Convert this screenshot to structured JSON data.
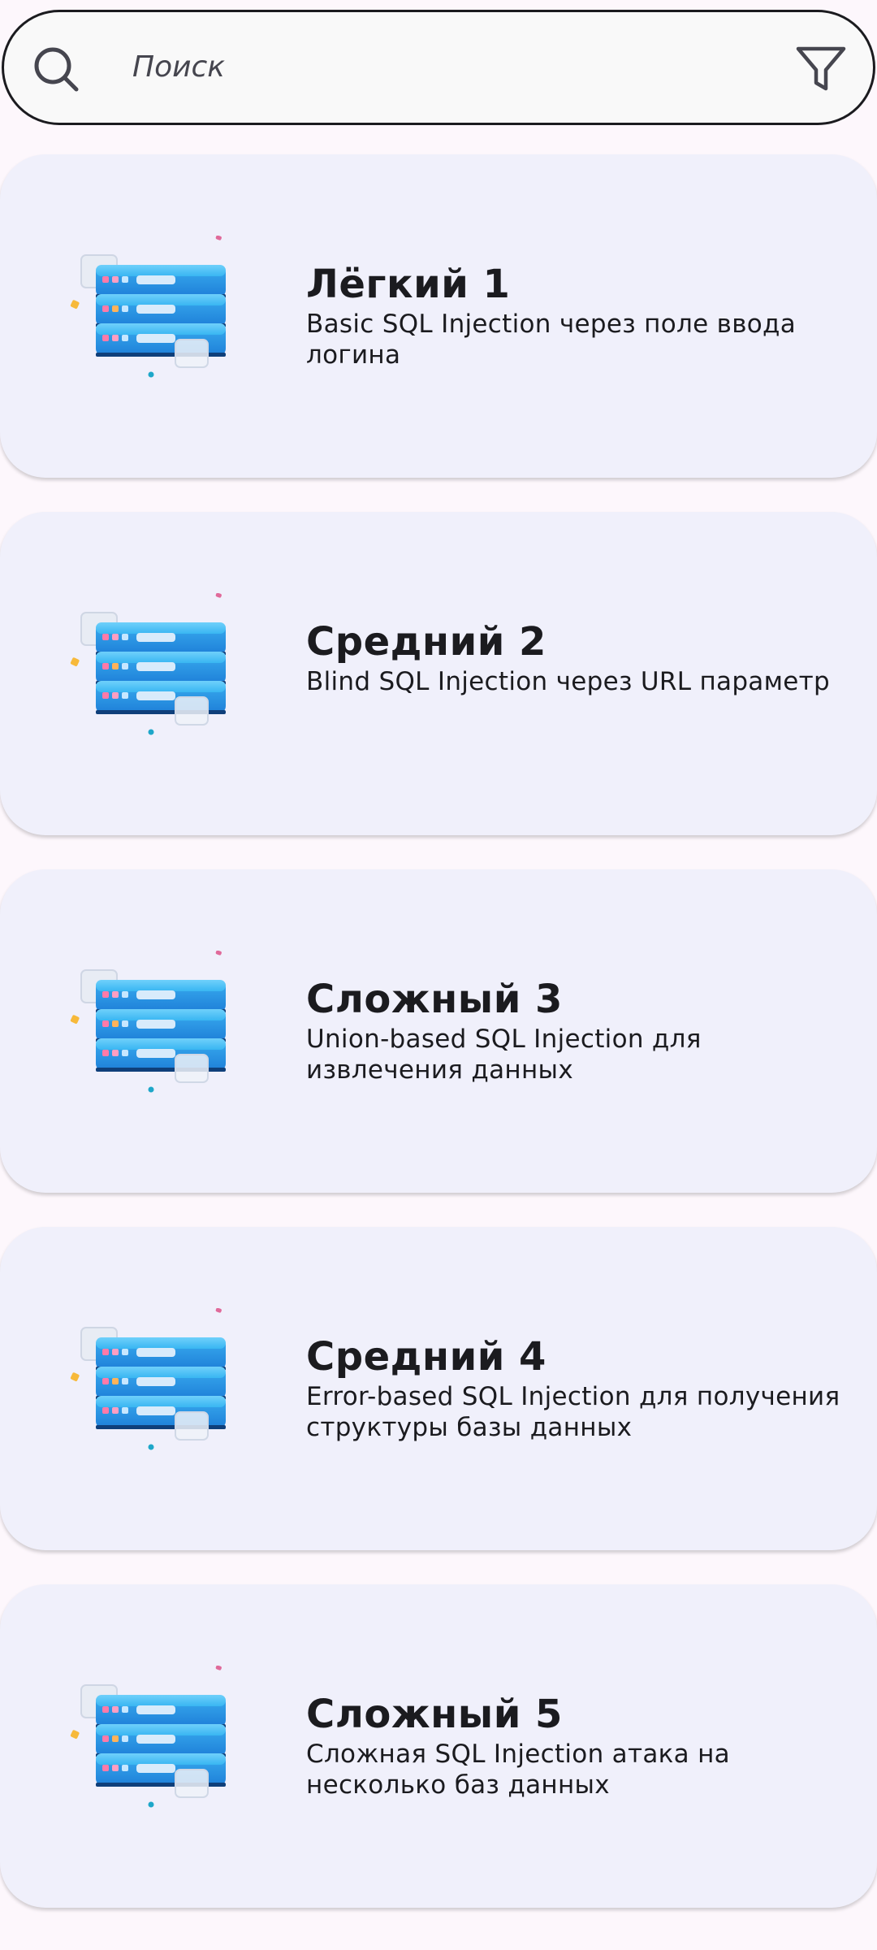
{
  "search": {
    "placeholder": "Поиск"
  },
  "tasks": [
    {
      "title": "Лёгкий 1",
      "description": "Basic SQL Injection через поле ввода логина",
      "icon": "server-stack-icon"
    },
    {
      "title": "Средний 2",
      "description": "Blind SQL Injection через URL параметр",
      "icon": "server-stack-icon"
    },
    {
      "title": "Сложный 3",
      "description": "Union-based SQL Injection для извлечения данных",
      "icon": "server-stack-icon"
    },
    {
      "title": "Средний 4",
      "description": "Error-based SQL Injection для получения структуры базы данных",
      "icon": "server-stack-icon"
    },
    {
      "title": "Сложный 5",
      "description": "Сложная SQL Injection атака на несколько баз данных",
      "icon": "server-stack-icon"
    }
  ],
  "colors": {
    "background": "#fdf7fc",
    "card": "#f0f0fb",
    "text": "#1b1b1f",
    "server_blue": "#2aa8e8"
  }
}
